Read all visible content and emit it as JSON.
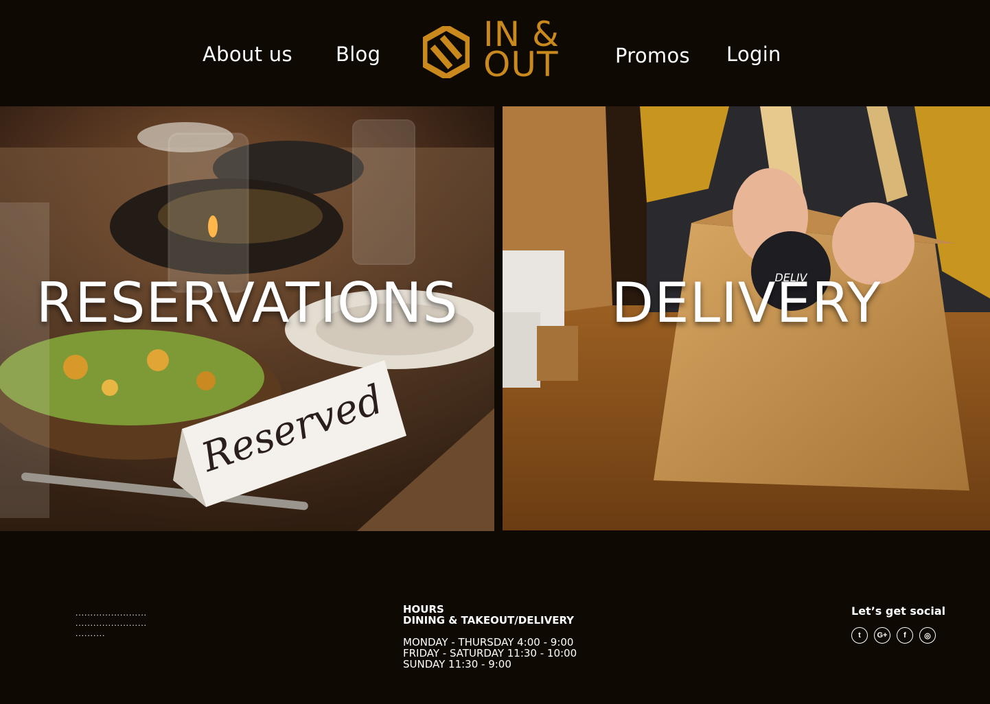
{
  "nav": {
    "left": [
      {
        "label": "About us"
      },
      {
        "label": "Blog"
      }
    ],
    "right": [
      {
        "label": "Promos"
      },
      {
        "label": "Login"
      }
    ]
  },
  "logo": {
    "line1": "IN &",
    "line2": "OUT",
    "color": "#c9891d"
  },
  "panels": {
    "reservations": {
      "title": "RESERVATIONS",
      "sign_text": "Reserved"
    },
    "delivery": {
      "title": "DELIVERY",
      "sticker_text": "DELIV"
    }
  },
  "footer": {
    "dots": [
      "........................",
      "........................",
      ".........."
    ],
    "hours": {
      "heading": "HOURS",
      "subheading": "DINING & TAKEOUT/DELIVERY",
      "lines": [
        "MONDAY - THURSDAY 4:00 - 9:00",
        "FRIDAY - SATURDAY 11:30 - 10:00",
        "SUNDAY 11:30 - 9:00"
      ]
    },
    "social": {
      "title": "Let’s get social",
      "icons": [
        {
          "name": "twitter-icon",
          "glyph": "t"
        },
        {
          "name": "google-plus-icon",
          "glyph": "G+"
        },
        {
          "name": "facebook-icon",
          "glyph": "f"
        },
        {
          "name": "instagram-icon",
          "glyph": "◎"
        }
      ]
    }
  }
}
